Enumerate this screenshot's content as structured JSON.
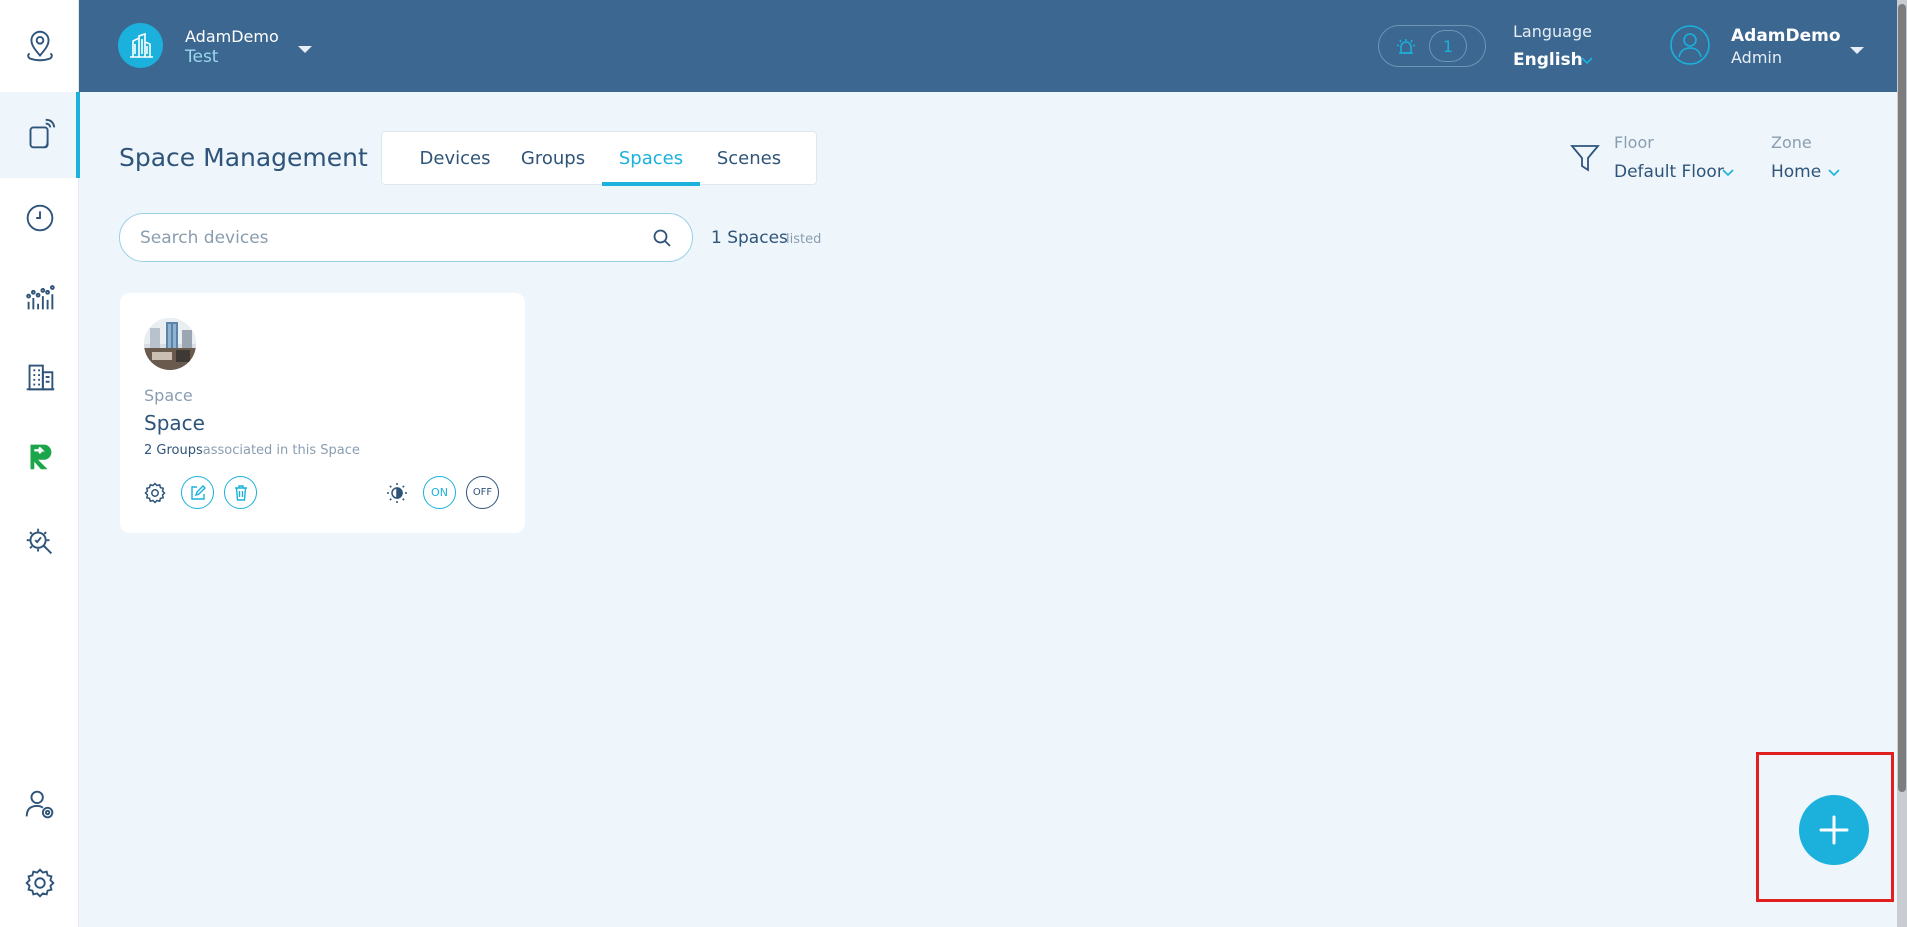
{
  "header": {
    "org_name": "AdamDemo",
    "org_site": "Test",
    "alarm_count": "1",
    "language_label": "Language",
    "language_value": "English",
    "user_name": "AdamDemo",
    "user_role": "Admin"
  },
  "sidebar": {
    "items": [
      {
        "icon": "map-pin-icon"
      },
      {
        "icon": "devices-icon",
        "active": true
      },
      {
        "icon": "clock-icon"
      },
      {
        "icon": "analytics-icon"
      },
      {
        "icon": "building-icon"
      },
      {
        "icon": "r-logo-icon"
      },
      {
        "icon": "diagnostics-icon"
      },
      {
        "icon": "user-settings-icon"
      },
      {
        "icon": "gear-icon"
      }
    ]
  },
  "main": {
    "title": "Space Management",
    "tabs": [
      {
        "label": "Devices"
      },
      {
        "label": "Groups"
      },
      {
        "label": "Spaces",
        "active": true
      },
      {
        "label": "Scenes"
      }
    ],
    "filters": {
      "floor_label": "Floor",
      "floor_value": "Default Floor",
      "zone_label": "Zone",
      "zone_value": "Home"
    },
    "search": {
      "placeholder": "Search devices"
    },
    "count": {
      "value": "1 Spaces",
      "suffix": "listed"
    },
    "cards": [
      {
        "type": "Space",
        "name": "Space",
        "groups_count": "2 Groups",
        "groups_text": "associated in this Space",
        "on_label": "ON",
        "off_label": "OFF"
      }
    ]
  },
  "colors": {
    "header_bg": "#3b6790",
    "accent": "#1bb1dc",
    "page_bg": "#eef6fc",
    "text_primary": "#2f5479",
    "highlight_outline": "#e0201f"
  }
}
